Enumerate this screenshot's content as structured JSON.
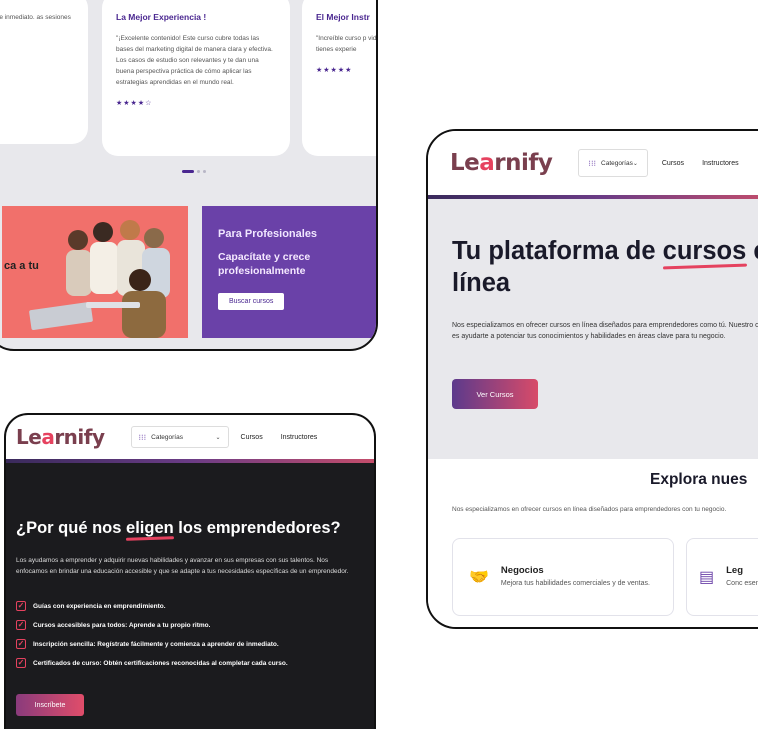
{
  "brand": {
    "logo": "Learnify",
    "accent": "#e5425f",
    "purple": "#6a41a8"
  },
  "testimonials": {
    "left": {
      "text": "ticos, con ejercicios idido de inmediato. as sesiones de ara perfeccionar tu"
    },
    "middle": {
      "title": "La Mejor Experiencia !",
      "text": "\"¡Excelente contenido! Este curso cubre todas las bases del marketing digital de manera clara y efectiva. Los casos de estudio son relevantes y te dan una buena perspectiva práctica de cómo aplicar las estrategias aprendidas en el mundo real.",
      "stars": "★★★★☆"
    },
    "right": {
      "title": "El Mejor Instr",
      "text": "\"Increíble curso p videos son concis no tienes experie",
      "stars": "★★★★★"
    }
  },
  "promo_photo": {
    "text": "ca a tu"
  },
  "promo_pro": {
    "title": "Para Profesionales",
    "subtitle": "Capacítate y crece profesionalmente",
    "button": "Buscar cursos"
  },
  "nav": {
    "categories": "Categorías",
    "links": [
      "Cursos",
      "Instructores"
    ],
    "icons": {
      "grid": "grid-dots-icon",
      "chevron": "chevron-down-icon"
    }
  },
  "why": {
    "title_pre": "¿Por qué nos ",
    "title_hl": "eligen",
    "title_post": " los emprendedores?",
    "desc": "Los ayudamos a emprender y adquirir nuevas habilidades y avanzar en sus empresas con sus talentos. Nos enfocamos en brindar una educación accesible y que se adapte a tus necesidades específicas de un emprendedor.",
    "features": [
      "Guías con experiencia en emprendimiento.",
      "Cursos accesibles para todos: Aprende a tu propio ritmo.",
      "Inscripción sencilla: Regístrate fácilmente y comienza a aprender de inmediato.",
      "Certificados de curso: Obtén certificaciones reconocidas al completar cada curso."
    ],
    "button": "Inscríbete"
  },
  "hero": {
    "title_pre": "Tu plataforma de ",
    "title_hl": "cursos",
    "title_post": " en línea",
    "desc": "Nos especializamos en ofrecer cursos en línea diseñados para emprendedores como tú. Nuestro objetivo es ayudarte a potenciar tus conocimientos y habilidades en áreas clave para tu negocio.",
    "button": "Ver Cursos"
  },
  "explore": {
    "title": "Explora nues",
    "desc": "Nos especializamos en ofrecer cursos en línea diseñados para emprendedores con tu negocio.",
    "categories": [
      {
        "title": "Negocios",
        "desc": "Mejora tus habilidades comerciales y de ventas.",
        "icon": "handshake-icon"
      },
      {
        "title": "Leg",
        "desc": "Conc esen marc",
        "icon": "document-icon"
      }
    ]
  }
}
